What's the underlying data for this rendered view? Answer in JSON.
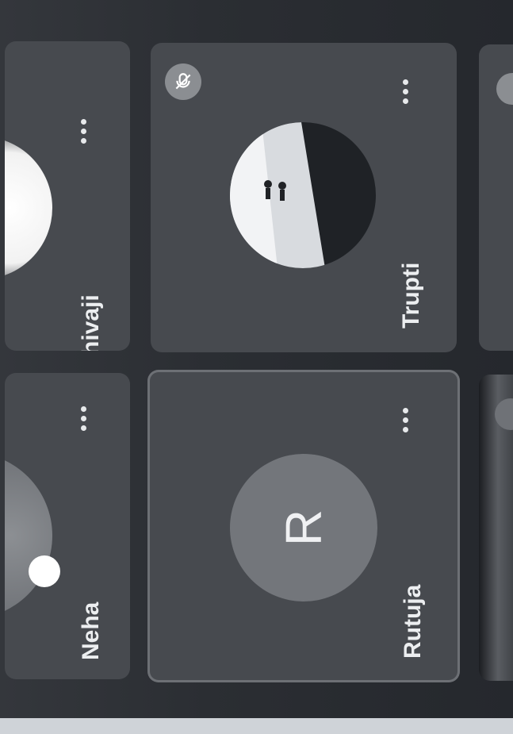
{
  "participants": [
    {
      "name": "Shivaji",
      "initial": "",
      "more_icon": "more-options-icon",
      "avatar": "photo"
    },
    {
      "name": "Neha",
      "initial": "",
      "more_icon": "more-options-icon",
      "avatar": "photo"
    },
    {
      "name": "Trupti",
      "initial": "",
      "more_icon": "more-options-icon",
      "avatar": "photo",
      "status_icon": "mic-off-icon"
    },
    {
      "name": "Rutuja",
      "initial": "R",
      "more_icon": "more-options-icon",
      "avatar": "initial",
      "active_speaker": true
    }
  ],
  "colors": {
    "background": "#2a2d32",
    "tile": "#474a4f",
    "avatar_bg": "#73767b",
    "text": "#eceef0"
  }
}
